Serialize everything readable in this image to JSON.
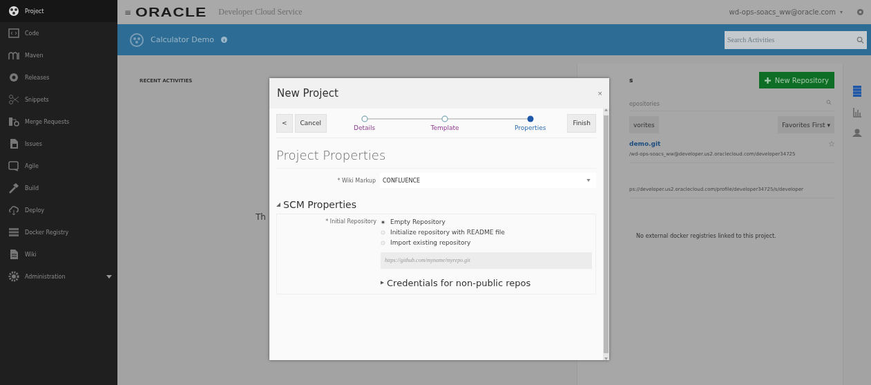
{
  "sidebar": {
    "items": [
      {
        "label": "Project",
        "selected": true
      },
      {
        "label": "Code",
        "selected": false
      },
      {
        "label": "Maven",
        "selected": false
      },
      {
        "label": "Releases",
        "selected": false
      },
      {
        "label": "Snippets",
        "selected": false
      },
      {
        "label": "Merge Requests",
        "selected": false
      },
      {
        "label": "Issues",
        "selected": false
      },
      {
        "label": "Agile",
        "selected": false
      },
      {
        "label": "Build",
        "selected": false
      },
      {
        "label": "Deploy",
        "selected": false
      },
      {
        "label": "Docker Registry",
        "selected": false
      },
      {
        "label": "Wiki",
        "selected": false
      },
      {
        "label": "Administration",
        "selected": false,
        "expandable": true
      }
    ]
  },
  "header": {
    "menu_glyph": "≡",
    "logo": "ORACLE",
    "product": "Developer Cloud Service",
    "user": "wd-ops-soacs_ww@oracle.com",
    "user_caret": "▾"
  },
  "project_bar": {
    "name": "Calculator Demo",
    "search": {
      "placeholder": "Search Activities"
    }
  },
  "recent_activities": {
    "title": "RECENT ACTIVITIES",
    "text": "Th"
  },
  "repositories": {
    "title": "s",
    "new_button": "New Repository",
    "filter": {
      "placeholder": "epositories"
    },
    "favorites_button": "vorites",
    "sort_button": "Favorites First",
    "sort_caret": "▾",
    "items": [
      {
        "name": "demo.git",
        "url": "/wd-ops-soacs_ww@developer.us2.oraclecloud.com/developer34725"
      },
      {
        "url": "ps://developer.us2.oraclecloud.com/profile/developer34725/s/developer"
      }
    ],
    "docker_note": "No external docker registries linked to this project."
  },
  "modal": {
    "title": "New Project",
    "close": "×",
    "back": "<",
    "cancel": "Cancel",
    "finish": "Finish",
    "steps": [
      {
        "label": "Details",
        "selected": false
      },
      {
        "label": "Template",
        "selected": false
      },
      {
        "label": "Properties",
        "selected": true
      }
    ],
    "heading": "Project Properties",
    "wiki_markup": {
      "required_mark": "*",
      "label": "Wiki Markup",
      "value": "CONFLUENCE"
    },
    "scm": {
      "title": "SCM Properties",
      "expanded": true,
      "required_mark": "*",
      "label": "Initial Repository",
      "options": [
        {
          "label": "Empty Repository",
          "selected": true
        },
        {
          "label": "Initialize repository with README file",
          "selected": false
        },
        {
          "label": "Import existing repository",
          "selected": false
        }
      ],
      "url_field": {
        "placeholder": "https://github.com/myname/myrepo.git"
      },
      "credentials": {
        "label": "Credentials for non-public repos",
        "expanded": false
      }
    }
  }
}
